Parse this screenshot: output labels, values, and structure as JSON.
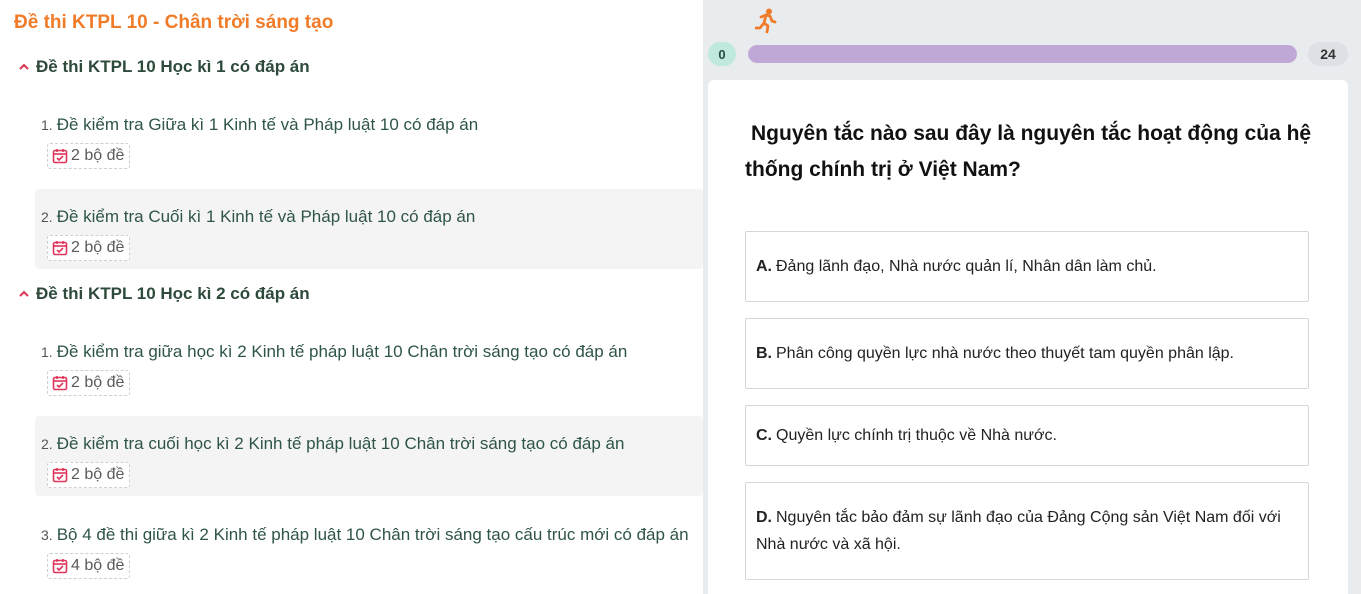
{
  "left": {
    "title": "Đề thi KTPL 10 - Chân trời sáng tạo",
    "sections": [
      {
        "heading": "Đề thi KTPL 10 Học kì 1 có đáp án",
        "items": [
          {
            "num": "1.",
            "title": "Đề kiểm tra Giữa kì 1 Kinh tế và Pháp luật 10 có đáp án",
            "badge": "2 bộ đề"
          },
          {
            "num": "2.",
            "title": "Đề kiểm tra Cuối kì 1 Kinh tế và Pháp luật 10 có đáp án",
            "badge": "2 bộ đề"
          }
        ]
      },
      {
        "heading": "Đề thi KTPL 10 Học kì 2 có đáp án",
        "items": [
          {
            "num": "1.",
            "title": "Đề kiểm tra giữa học kì 2 Kinh tế pháp luật 10 Chân trời sáng tạo có đáp án",
            "badge": "2 bộ đề"
          },
          {
            "num": "2.",
            "title": "Đề kiểm tra cuối học kì 2 Kinh tế pháp luật 10 Chân trời sáng tạo có đáp án",
            "badge": "2 bộ đề"
          },
          {
            "num": "3.",
            "title": "Bộ 4 đề thi giữa kì 2 Kinh tế pháp luật 10 Chân trời sáng tạo cấu trúc mới có đáp án",
            "badge": "4 bộ đề"
          }
        ]
      }
    ]
  },
  "quiz": {
    "progress_start": "0",
    "progress_end": "24",
    "progress_fraction": 1.0,
    "question": "Nguyên tắc nào sau đây là nguyên tắc hoạt động của hệ thống chính trị ở Việt Nam?",
    "options": [
      {
        "letter": "A.",
        "text": "Đảng lãnh đạo, Nhà nước quản lí, Nhân dân làm chủ."
      },
      {
        "letter": "B.",
        "text": "Phân công quyền lực nhà nước theo thuyết tam quyền phân lập."
      },
      {
        "letter": "C.",
        "text": "Quyền lực chính trị thuộc về Nhà nước."
      },
      {
        "letter": "D.",
        "text": "Nguyên tắc bảo đảm sự lãnh đạo của Đảng Cộng sản Việt Nam đối với Nhà nước và xã hội."
      }
    ]
  },
  "colors": {
    "title_orange": "#f07c2a",
    "progress_fill": "#c0a8d6",
    "badge_icon": "#e0345a",
    "start_pill": "#bfe9df"
  },
  "icons": {
    "section_toggle": "chevron-up-icon",
    "badge": "calendar-check-icon",
    "runner": "running-person-icon"
  }
}
